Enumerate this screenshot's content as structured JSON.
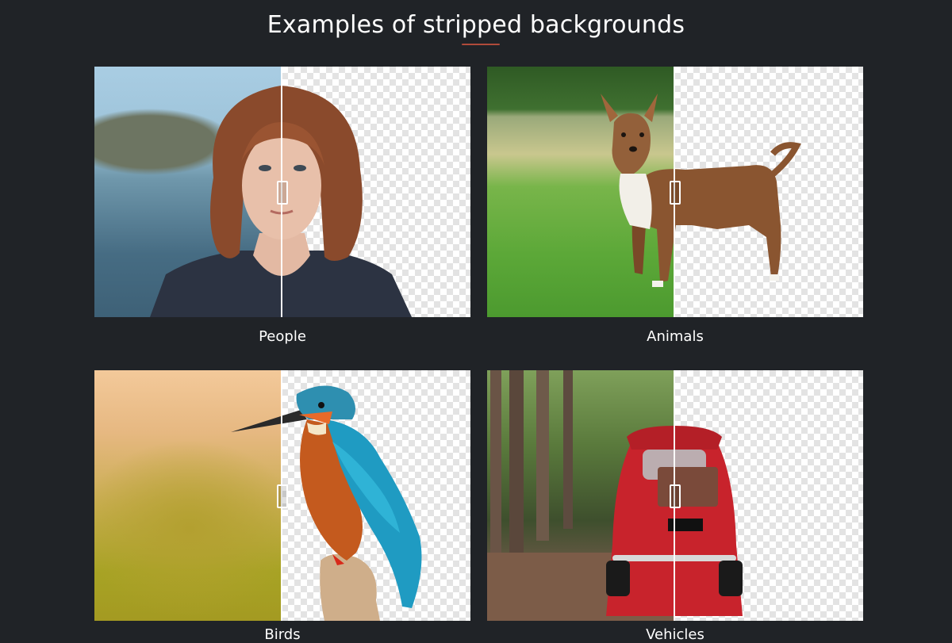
{
  "page": {
    "title": "Examples of stripped backgrounds"
  },
  "examples": [
    {
      "label": "People"
    },
    {
      "label": "Animals"
    },
    {
      "label": "Birds"
    },
    {
      "label": "Vehicles"
    }
  ],
  "colors": {
    "page_background": "#202327",
    "text": "#ffffff",
    "checker_light": "#ffffff",
    "checker_dark": "#e3e3e3"
  }
}
